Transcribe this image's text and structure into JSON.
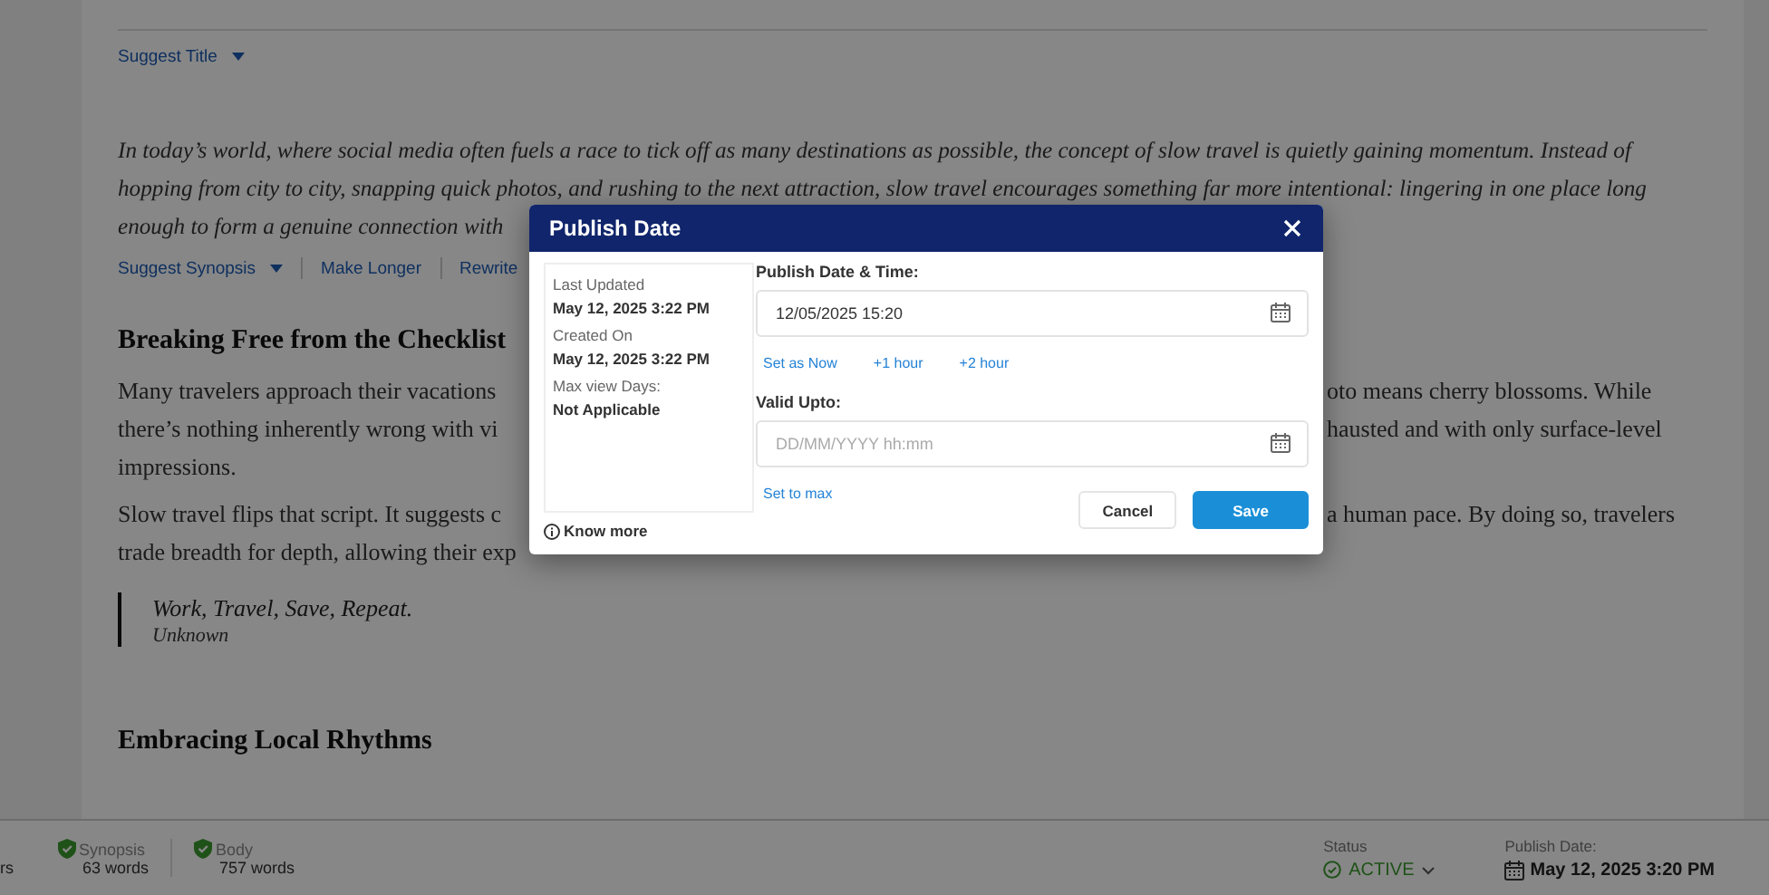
{
  "editor": {
    "title_actions": [
      {
        "label": "Suggest Title",
        "dropdown": true
      }
    ],
    "blocks": [
      {
        "kind": "intro",
        "lines": [
          {
            "left": "In today’s world, where social media often fuels a race to tick off as many destinations as possible, the concept of slow travel is quietly gaining momentum. Instead of"
          },
          {
            "left": "hopping from city to city, snapping quick photos, and rushing to the next attraction, slow travel encourages something far more intentional: lingering in one place long"
          },
          {
            "left": "enough to form a genuine connection with"
          }
        ]
      },
      {
        "kind": "actions",
        "items": [
          {
            "label": "Suggest Synopsis",
            "dropdown": true
          },
          {
            "label": "Make Longer",
            "dropdown": false
          },
          {
            "label": "Rewrite",
            "dropdown": false
          }
        ]
      },
      {
        "kind": "heading",
        "text": "Breaking Free from the Checklist"
      },
      {
        "kind": "paragraph",
        "lines": [
          {
            "left": "Many travelers approach their vacations",
            "right": "oto means cherry blossoms. While"
          },
          {
            "left": "there’s nothing inherently wrong with vi",
            "right": "hausted and with only surface-level"
          },
          {
            "left": "impressions."
          }
        ]
      },
      {
        "kind": "paragraph",
        "lines": [
          {
            "left": "Slow travel flips that script. It suggests c",
            "right": "a human pace. By doing so, travelers"
          },
          {
            "left": "trade breadth for depth, allowing their exp"
          }
        ]
      },
      {
        "kind": "quote",
        "text": "Work, Travel, Save, Repeat.",
        "author": "Unknown"
      },
      {
        "kind": "heading",
        "text": "Embracing Local Rhythms"
      }
    ]
  },
  "footer": {
    "counts": [
      {
        "value": "rs",
        "valid": false
      },
      {
        "label": "Synopsis",
        "value": "63 words",
        "valid": true
      },
      {
        "label": "Body",
        "value": "757 words",
        "valid": true
      }
    ],
    "status": {
      "label": "Status",
      "value": "ACTIVE"
    },
    "publish_date": {
      "label": "Publish Date:",
      "value": "May 12, 2025 3:20 PM"
    }
  },
  "dialog": {
    "title": "Publish Date",
    "info": [
      {
        "label": "Last Updated",
        "value": "May 12, 2025 3:22 PM"
      },
      {
        "label": "Created On",
        "value": "May 12, 2025 3:22 PM"
      },
      {
        "label": "Max view Days:",
        "value": "Not Applicable"
      }
    ],
    "know_more": "Know more",
    "fields": [
      {
        "label": "Publish Date & Time:",
        "value": "12/05/2025 15:20",
        "quick": [
          "Set as Now",
          "+1 hour",
          "+2 hour"
        ]
      },
      {
        "label": "Valid Upto:",
        "placeholder": "DD/MM/YYYY hh:mm",
        "quick": [
          "Set to max"
        ]
      }
    ],
    "buttons": [
      {
        "label": "Cancel",
        "kind": "secondary"
      },
      {
        "label": "Save",
        "kind": "primary"
      }
    ]
  }
}
